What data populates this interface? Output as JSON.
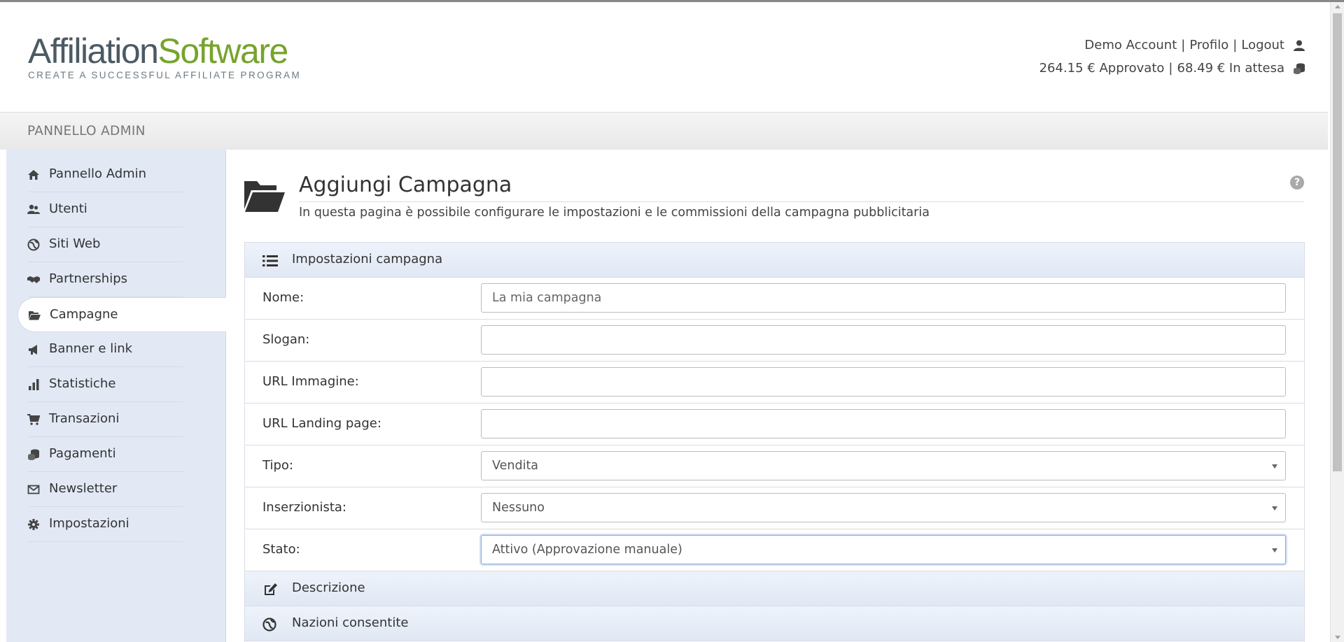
{
  "header": {
    "logo": {
      "part1": "Affiliation",
      "part2": "Software",
      "tagline": "CREATE A SUCCESSFUL AFFILIATE PROGRAM"
    },
    "user_links": {
      "account": "Demo Account",
      "profile": "Profilo",
      "logout": "Logout",
      "separator": "|"
    },
    "balance": {
      "approved": "264.15 € Approvato",
      "pending": "68.49 € In attesa",
      "separator": "|"
    }
  },
  "panel": {
    "title": "PANNELLO ADMIN"
  },
  "sidebar": {
    "items": [
      {
        "label": "Pannello Admin",
        "icon": "home-icon"
      },
      {
        "label": "Utenti",
        "icon": "users-icon"
      },
      {
        "label": "Siti Web",
        "icon": "globe-icon"
      },
      {
        "label": "Partnerships",
        "icon": "handshake-icon"
      },
      {
        "label": "Campagne",
        "icon": "folder-open-icon",
        "active": true
      },
      {
        "label": "Banner e link",
        "icon": "megaphone-icon"
      },
      {
        "label": "Statistiche",
        "icon": "bar-chart-icon"
      },
      {
        "label": "Transazioni",
        "icon": "cart-icon"
      },
      {
        "label": "Pagamenti",
        "icon": "coins-icon"
      },
      {
        "label": "Newsletter",
        "icon": "envelope-icon"
      },
      {
        "label": "Impostazioni",
        "icon": "gear-icon"
      }
    ]
  },
  "page": {
    "title": "Aggiungi Campagna",
    "subtitle": "In questa pagina è possibile configurare le impostazioni e le commissioni della campagna pubblicitaria",
    "help": "?"
  },
  "form": {
    "section_settings": "Impostazioni campagna",
    "fields": {
      "nome": {
        "label": "Nome:",
        "placeholder": "La mia campagna",
        "value": ""
      },
      "slogan": {
        "label": "Slogan:",
        "value": ""
      },
      "url_immagine": {
        "label": "URL Immagine:",
        "value": ""
      },
      "url_landing": {
        "label": "URL Landing page:",
        "value": ""
      },
      "tipo": {
        "label": "Tipo:",
        "selected": "Vendita"
      },
      "inserzionista": {
        "label": "Inserzionista:",
        "selected": "Nessuno"
      },
      "stato": {
        "label": "Stato:",
        "selected": "Attivo (Approvazione manuale)"
      }
    },
    "section_description": "Descrizione",
    "section_countries": "Nazioni consentite"
  },
  "colors": {
    "brand_dark": "#4c5a63",
    "brand_green": "#76a42c",
    "sidebar_bg": "#e2e9f5"
  }
}
